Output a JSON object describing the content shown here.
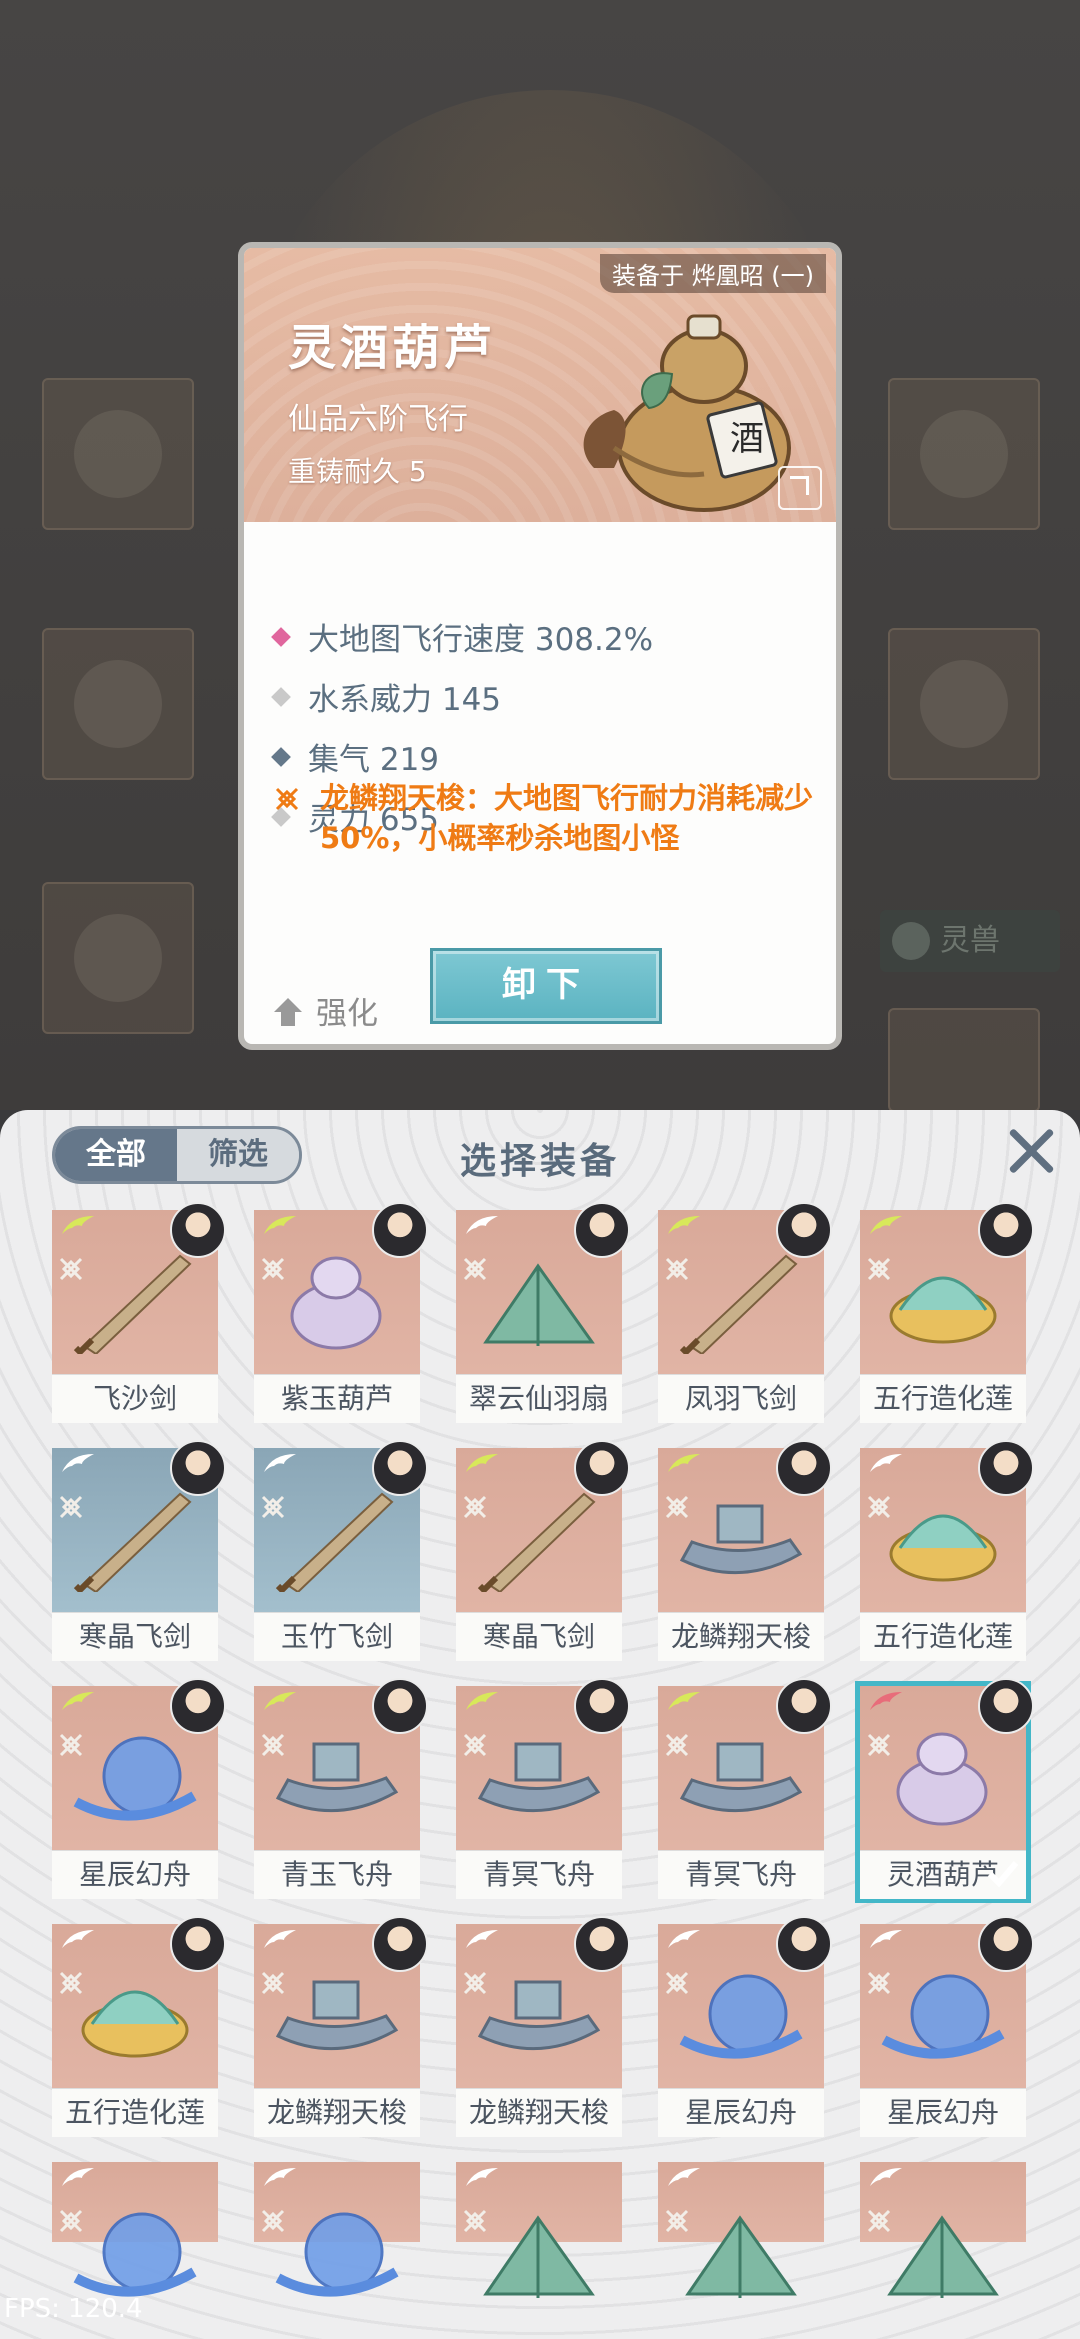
{
  "detail": {
    "equipped_by": "装备于 烨凰昭 (一)",
    "name": "灵酒葫芦",
    "grade": "仙品六阶飞行",
    "durability": "重铸耐久 5",
    "stats": [
      {
        "text": "大地图飞行速度 308.2%",
        "color": "#e0669d"
      },
      {
        "text": "水系威力 145",
        "color": "#c9c9c9"
      },
      {
        "text": "集气 219",
        "color": "#64788a"
      },
      {
        "text": "灵力 655",
        "color": "#c9c9c9"
      }
    ],
    "special_text": "龙鳞翔天梭：大地图飞行耐力消耗减少50%，小概率秒杀地图小怪",
    "enhance_label": "强化",
    "unequip_label": "卸下"
  },
  "panel": {
    "filter_all": "全部",
    "filter_screen": "筛选",
    "title": "选择装备"
  },
  "items": [
    {
      "name": "飞沙剑",
      "tone": "warm",
      "wing": "#d8e85a",
      "obj": "sword"
    },
    {
      "name": "紫玉葫芦",
      "tone": "warm",
      "wing": "#d8e85a",
      "obj": "gourd"
    },
    {
      "name": "翠云仙羽扇",
      "tone": "warm",
      "wing": "#ffffff",
      "obj": "fan"
    },
    {
      "name": "凤羽飞剑",
      "tone": "warm",
      "wing": "#d8e85a",
      "obj": "sword"
    },
    {
      "name": "五行造化莲",
      "tone": "warm",
      "wing": "#d8e85a",
      "obj": "lotus"
    },
    {
      "name": "寒晶飞剑",
      "tone": "cold",
      "wing": "#ffffff",
      "obj": "sword"
    },
    {
      "name": "玉竹飞剑",
      "tone": "cold",
      "wing": "#ffffff",
      "obj": "sword"
    },
    {
      "name": "寒晶飞剑",
      "tone": "warm",
      "wing": "#d8e85a",
      "obj": "sword"
    },
    {
      "name": "龙鳞翔天梭",
      "tone": "warm",
      "wing": "#d8e85a",
      "obj": "boat"
    },
    {
      "name": "五行造化莲",
      "tone": "warm",
      "wing": "#ffffff",
      "obj": "lotus"
    },
    {
      "name": "星辰幻舟",
      "tone": "warm",
      "wing": "#d8e85a",
      "obj": "orb"
    },
    {
      "name": "青玉飞舟",
      "tone": "warm",
      "wing": "#d8e85a",
      "obj": "boat"
    },
    {
      "name": "青冥飞舟",
      "tone": "warm",
      "wing": "#d8e85a",
      "obj": "boat"
    },
    {
      "name": "青冥飞舟",
      "tone": "warm",
      "wing": "#d8e85a",
      "obj": "boat"
    },
    {
      "name": "灵酒葫芦",
      "tone": "warm",
      "wing": "#e86c7a",
      "obj": "gourd",
      "selected": true
    },
    {
      "name": "五行造化莲",
      "tone": "warm",
      "wing": "#ffffff",
      "obj": "lotus"
    },
    {
      "name": "龙鳞翔天梭",
      "tone": "warm",
      "wing": "#ffffff",
      "obj": "boat"
    },
    {
      "name": "龙鳞翔天梭",
      "tone": "warm",
      "wing": "#ffffff",
      "obj": "boat"
    },
    {
      "name": "星辰幻舟",
      "tone": "warm",
      "wing": "#ffffff",
      "obj": "orb"
    },
    {
      "name": "星辰幻舟",
      "tone": "warm",
      "wing": "#ffffff",
      "obj": "orb"
    },
    {
      "name": "",
      "tone": "warm",
      "wing": "#ffffff",
      "obj": "orb",
      "partial": true
    },
    {
      "name": "",
      "tone": "warm",
      "wing": "#ffffff",
      "obj": "orb",
      "partial": true
    },
    {
      "name": "",
      "tone": "warm",
      "wing": "#ffffff",
      "obj": "fan",
      "partial": true
    },
    {
      "name": "",
      "tone": "warm",
      "wing": "#ffffff",
      "obj": "fan",
      "partial": true
    },
    {
      "name": "",
      "tone": "warm",
      "wing": "#ffffff",
      "obj": "fan",
      "partial": true
    }
  ],
  "fps": "FPS: 120.4",
  "background": {
    "beast_tab": "灵兽"
  }
}
